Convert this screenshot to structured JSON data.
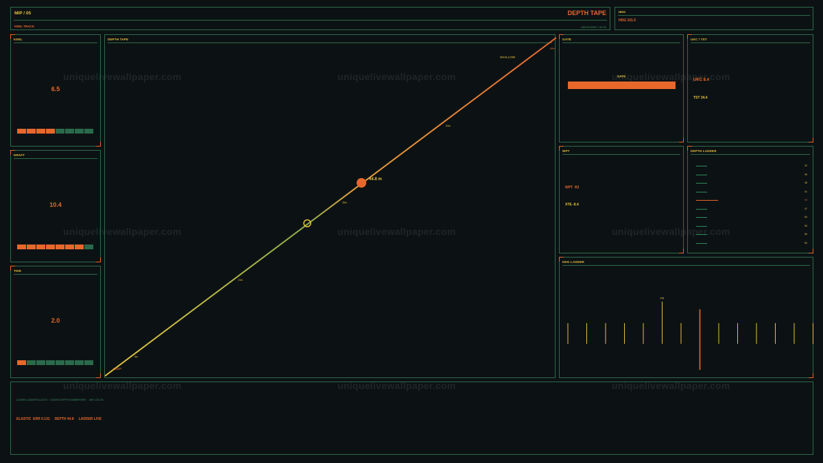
{
  "header": {
    "app_id": "MIP / 05",
    "title": "DEPTH TAPE",
    "subtitle": "KEEL TRACK",
    "right_note": "MEASURED / 00:06"
  },
  "hdg_box": {
    "title": "HDG",
    "value": "HDG 101.5"
  },
  "keel": {
    "title": "KEEL",
    "value": "6.5",
    "level": 4,
    "segments": 8
  },
  "draft": {
    "title": "DRAFT",
    "value": "10.4",
    "level": 7,
    "segments": 8
  },
  "tide": {
    "title": "TIDE",
    "value": "2.0",
    "level": 1,
    "segments": 8
  },
  "depth_tape": {
    "title": "DEPTH TAPE",
    "label_deep": "DEEP",
    "label_shallow": "SHALLOW",
    "marker_value": "44.8 m",
    "ticks": [
      "8m",
      "23m",
      "38m",
      "53m",
      "68m"
    ]
  },
  "gate": {
    "title": "GATE",
    "label": "GATE",
    "fill": 1.0
  },
  "ukc": {
    "title": "UKC / TST",
    "ukc": "UKC 8.4",
    "tst": "TST 34.4"
  },
  "wpt": {
    "title": "WPT",
    "wpt": "WPT  R2",
    "xte": "XTE -8.4"
  },
  "depth_ladder": {
    "title": "DEPTH LADDER",
    "labels": [
      "32",
      "35",
      "38",
      "41",
      "44",
      "47",
      "50",
      "53",
      "56",
      "59"
    ],
    "active_index": 4
  },
  "hdg_ladder": {
    "title": "HDG LADDER",
    "peak_label": "096",
    "bars": [
      0.27,
      0.27,
      0.27,
      0.27,
      0.27,
      0.55,
      0.27,
      1.0,
      0.27,
      0.27,
      0.27,
      0.27,
      0.27,
      0.27
    ],
    "active_index": 7,
    "peak_index": 5
  },
  "footer": {
    "meta": "AXIOMS LADDER ELASTIC  /  NAVIKE DEPTH NUMBER MRK  ·  MIP-1472-90",
    "status": "ELASTIC  ERR 0.131     DEPTH 44.8     LADDER LIVE"
  },
  "watermark": "uniquelivewallpaper.com",
  "colors": {
    "accent": "#e8682c",
    "text": "#e8c23c",
    "border": "#2f6a4a",
    "bg": "#0c1214"
  }
}
